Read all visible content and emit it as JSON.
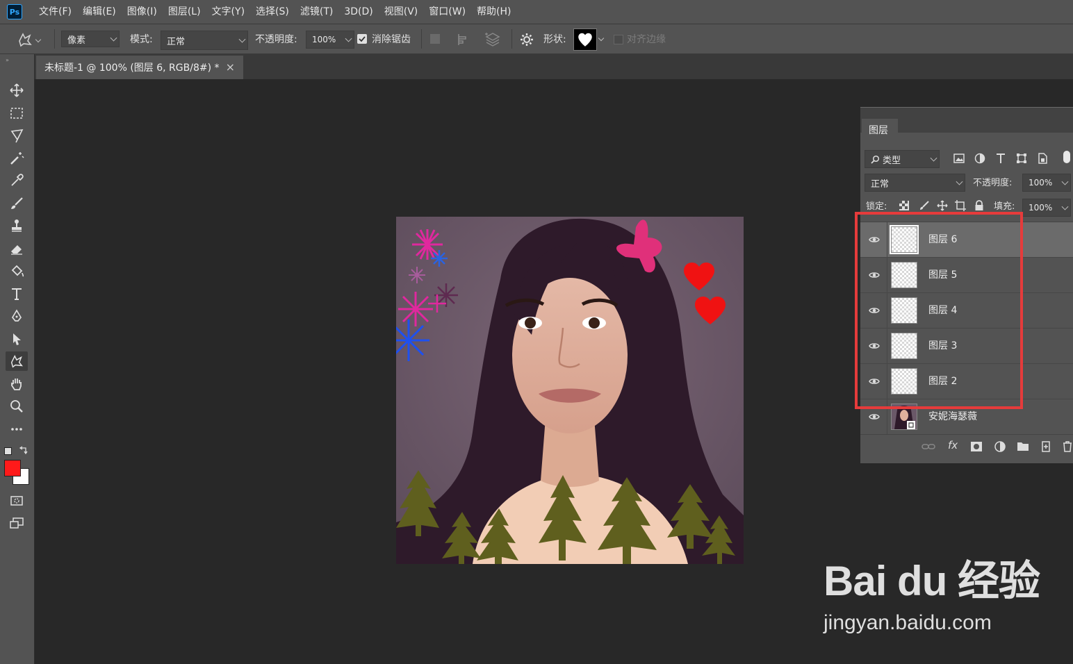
{
  "app": {
    "logo": "Ps"
  },
  "menu": [
    "文件(F)",
    "编辑(E)",
    "图像(I)",
    "图层(L)",
    "文字(Y)",
    "选择(S)",
    "滤镜(T)",
    "3D(D)",
    "视图(V)",
    "窗口(W)",
    "帮助(H)"
  ],
  "options": {
    "tool_icon": "custom-shape-icon",
    "mode_type": "像素",
    "mode_label": "模式:",
    "mode_value": "正常",
    "opacity_label": "不透明度:",
    "opacity_value": "100%",
    "antialias_label": "消除锯齿",
    "antialias_checked": true,
    "shape_label": "形状:",
    "shape_icon": "heart-icon",
    "align_edges_label": "对齐边缘"
  },
  "document": {
    "tab_title": "未标题-1 @ 100% (图层 6, RGB/8#) *"
  },
  "tools": [
    "move-icon",
    "marquee-icon",
    "lasso-icon",
    "magic-wand-icon",
    "eyedropper-icon",
    "brush-icon",
    "stamp-icon",
    "eraser-icon",
    "paint-bucket-icon",
    "type-icon",
    "pen-icon",
    "path-select-icon",
    "custom-shape-icon",
    "hand-icon",
    "zoom-icon",
    "more-icon"
  ],
  "colors": {
    "foreground": "#ff1a1a",
    "background": "#ffffff",
    "highlight": "#e63b3b"
  },
  "layers_panel": {
    "tab": "图层",
    "filter_kind": "类型",
    "blend_mode": "正常",
    "opacity_label": "不透明度:",
    "opacity_value": "100%",
    "lock_label": "锁定:",
    "fill_label": "填充:",
    "fill_value": "100%",
    "layers": [
      {
        "name": "图层 6",
        "selected": true
      },
      {
        "name": "图层 5",
        "selected": false
      },
      {
        "name": "图层 4",
        "selected": false
      },
      {
        "name": "图层 3",
        "selected": false
      },
      {
        "name": "图层 2",
        "selected": false
      },
      {
        "name": "安妮海瑟薇",
        "selected": false
      }
    ]
  },
  "watermark": {
    "logo": "Bai du 经验",
    "url": "jingyan.baidu.com"
  }
}
